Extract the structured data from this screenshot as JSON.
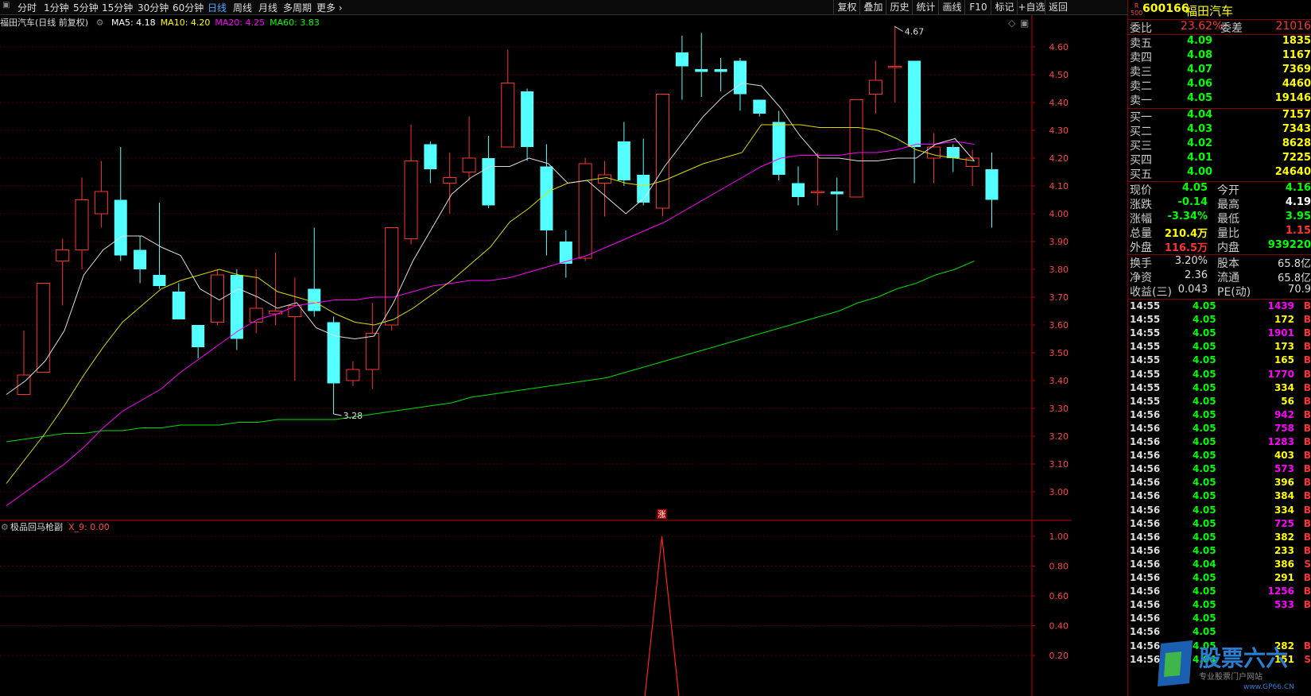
{
  "toolbar": {
    "periods": [
      {
        "label": "分时",
        "active": false
      },
      {
        "label": "1分钟",
        "active": false
      },
      {
        "label": "5分钟",
        "active": false
      },
      {
        "label": "15分钟",
        "active": false
      },
      {
        "label": "30分钟",
        "active": false
      },
      {
        "label": "60分钟",
        "active": false
      },
      {
        "label": "日线",
        "active": true
      },
      {
        "label": "周线",
        "active": false
      },
      {
        "label": "月线",
        "active": false
      },
      {
        "label": "多周期",
        "active": false
      },
      {
        "label": "更多",
        "active": false
      }
    ],
    "right_buttons": [
      "复权",
      "叠加",
      "历史",
      "统计",
      "画线",
      "F10",
      "标记",
      "+自选",
      "返回"
    ]
  },
  "chart_header": {
    "title": "福田汽车(日线 前复权)",
    "ma": [
      {
        "label": "MA5: 4.18",
        "color": "#ffffff"
      },
      {
        "label": "MA10: 4.20",
        "color": "#ffff00"
      },
      {
        "label": "MA20: 4.25",
        "color": "#ff00ff"
      },
      {
        "label": "MA60: 3.83",
        "color": "#00ff00"
      }
    ]
  },
  "chart_data": {
    "type": "candlestick",
    "price_axis": {
      "min": 2.9,
      "max": 4.7,
      "ticks": [
        "4.60",
        "4.50",
        "4.40",
        "4.30",
        "4.20",
        "4.10",
        "4.00",
        "3.90",
        "3.80",
        "3.70",
        "3.60",
        "3.50",
        "3.40",
        "3.30",
        "3.20",
        "3.10",
        "3.00"
      ]
    },
    "candles": [
      {
        "o": 3.35,
        "h": 3.58,
        "l": 3.35,
        "c": 3.42
      },
      {
        "o": 3.43,
        "h": 3.75,
        "l": 3.43,
        "c": 3.75
      },
      {
        "o": 3.83,
        "h": 3.91,
        "l": 3.67,
        "c": 3.87
      },
      {
        "o": 3.87,
        "h": 4.13,
        "l": 3.8,
        "c": 4.05
      },
      {
        "o": 4.0,
        "h": 4.19,
        "l": 3.95,
        "c": 4.08
      },
      {
        "o": 4.05,
        "h": 4.24,
        "l": 3.83,
        "c": 3.85
      },
      {
        "o": 3.87,
        "h": 3.92,
        "l": 3.75,
        "c": 3.8
      },
      {
        "o": 3.78,
        "h": 4.04,
        "l": 3.73,
        "c": 3.74
      },
      {
        "o": 3.72,
        "h": 3.75,
        "l": 3.63,
        "c": 3.62
      },
      {
        "o": 3.6,
        "h": 3.6,
        "l": 3.48,
        "c": 3.52
      },
      {
        "o": 3.61,
        "h": 3.8,
        "l": 3.6,
        "c": 3.78
      },
      {
        "o": 3.78,
        "h": 3.8,
        "l": 3.51,
        "c": 3.55
      },
      {
        "o": 3.61,
        "h": 3.8,
        "l": 3.57,
        "c": 3.66
      },
      {
        "o": 3.64,
        "h": 3.86,
        "l": 3.6,
        "c": 3.65
      },
      {
        "o": 3.63,
        "h": 3.77,
        "l": 3.4,
        "c": 3.67
      },
      {
        "o": 3.73,
        "h": 3.95,
        "l": 3.63,
        "c": 3.65
      },
      {
        "o": 3.61,
        "h": 3.63,
        "l": 3.28,
        "c": 3.39
      },
      {
        "o": 3.4,
        "h": 3.47,
        "l": 3.38,
        "c": 3.44
      },
      {
        "o": 3.44,
        "h": 3.68,
        "l": 3.37,
        "c": 3.57
      },
      {
        "o": 3.6,
        "h": 3.94,
        "l": 3.58,
        "c": 3.95
      },
      {
        "o": 3.91,
        "h": 4.32,
        "l": 3.89,
        "c": 4.19
      },
      {
        "o": 4.25,
        "h": 4.26,
        "l": 4.11,
        "c": 4.16
      },
      {
        "o": 4.11,
        "h": 4.22,
        "l": 4.0,
        "c": 4.13
      },
      {
        "o": 4.15,
        "h": 4.35,
        "l": 4.12,
        "c": 4.2
      },
      {
        "o": 4.2,
        "h": 4.28,
        "l": 4.02,
        "c": 4.03
      },
      {
        "o": 4.24,
        "h": 4.59,
        "l": 4.24,
        "c": 4.47
      },
      {
        "o": 4.44,
        "h": 4.45,
        "l": 4.19,
        "c": 4.24
      },
      {
        "o": 4.17,
        "h": 4.25,
        "l": 3.85,
        "c": 3.94
      },
      {
        "o": 3.9,
        "h": 3.94,
        "l": 3.77,
        "c": 3.82
      },
      {
        "o": 3.84,
        "h": 4.2,
        "l": 3.83,
        "c": 4.18
      },
      {
        "o": 4.11,
        "h": 4.19,
        "l": 3.99,
        "c": 4.14
      },
      {
        "o": 4.26,
        "h": 4.33,
        "l": 4.1,
        "c": 4.12
      },
      {
        "o": 4.14,
        "h": 4.27,
        "l": 4.03,
        "c": 4.04
      },
      {
        "o": 4.02,
        "h": 4.43,
        "l": 3.99,
        "c": 4.43
      },
      {
        "o": 4.58,
        "h": 4.64,
        "l": 4.41,
        "c": 4.53
      },
      {
        "o": 4.52,
        "h": 4.65,
        "l": 4.42,
        "c": 4.51
      },
      {
        "o": 4.52,
        "h": 4.56,
        "l": 4.44,
        "c": 4.51
      },
      {
        "o": 4.55,
        "h": 4.56,
        "l": 4.37,
        "c": 4.43
      },
      {
        "o": 4.41,
        "h": 4.41,
        "l": 4.35,
        "c": 4.36
      },
      {
        "o": 4.33,
        "h": 4.37,
        "l": 4.12,
        "c": 4.14
      },
      {
        "o": 4.11,
        "h": 4.17,
        "l": 4.03,
        "c": 4.06
      },
      {
        "o": 4.08,
        "h": 4.22,
        "l": 4.03,
        "c": 4.08
      },
      {
        "o": 4.08,
        "h": 4.13,
        "l": 3.94,
        "c": 4.07
      },
      {
        "o": 4.06,
        "h": 4.4,
        "l": 4.06,
        "c": 4.41
      },
      {
        "o": 4.43,
        "h": 4.55,
        "l": 4.36,
        "c": 4.48
      },
      {
        "o": 4.53,
        "h": 4.67,
        "l": 4.4,
        "c": 4.53
      },
      {
        "o": 4.55,
        "h": 4.55,
        "l": 4.11,
        "c": 4.24
      },
      {
        "o": 4.2,
        "h": 4.29,
        "l": 4.11,
        "c": 4.24
      },
      {
        "o": 4.24,
        "h": 4.25,
        "l": 4.15,
        "c": 4.2
      },
      {
        "o": 4.17,
        "h": 4.23,
        "l": 4.1,
        "c": 4.2
      },
      {
        "o": 4.16,
        "h": 4.22,
        "l": 3.95,
        "c": 4.05
      }
    ],
    "ma5": [
      3.35,
      3.4,
      3.47,
      3.58,
      3.78,
      3.87,
      3.92,
      3.92,
      3.88,
      3.85,
      3.73,
      3.69,
      3.73,
      3.7,
      3.66,
      3.68,
      3.59,
      3.56,
      3.55,
      3.56,
      3.68,
      3.83,
      3.95,
      4.07,
      4.13,
      4.17,
      4.17,
      4.2,
      4.18,
      4.11,
      4.12,
      4.06,
      4.0,
      4.06,
      4.17,
      4.26,
      4.35,
      4.42,
      4.47,
      4.46,
      4.38,
      4.28,
      4.2,
      4.2,
      4.19,
      4.19,
      4.2,
      4.2,
      4.25,
      4.27,
      4.19
    ],
    "ma10": [
      3.03,
      3.12,
      3.21,
      3.31,
      3.42,
      3.52,
      3.61,
      3.67,
      3.73,
      3.76,
      3.78,
      3.8,
      3.78,
      3.77,
      3.72,
      3.7,
      3.68,
      3.64,
      3.61,
      3.6,
      3.62,
      3.66,
      3.71,
      3.76,
      3.82,
      3.88,
      3.97,
      4.02,
      4.08,
      4.11,
      4.12,
      4.13,
      4.11,
      4.1,
      4.12,
      4.15,
      4.18,
      4.2,
      4.22,
      4.32,
      4.32,
      4.32,
      4.31,
      4.31,
      4.31,
      4.3,
      4.27,
      4.23,
      4.21,
      4.2,
      4.19
    ],
    "ma20": [
      2.95,
      3.0,
      3.05,
      3.1,
      3.16,
      3.23,
      3.29,
      3.33,
      3.37,
      3.43,
      3.48,
      3.53,
      3.58,
      3.62,
      3.64,
      3.67,
      3.68,
      3.69,
      3.69,
      3.7,
      3.7,
      3.72,
      3.74,
      3.75,
      3.76,
      3.76,
      3.77,
      3.79,
      3.81,
      3.83,
      3.85,
      3.88,
      3.91,
      3.94,
      3.97,
      4.01,
      4.05,
      4.09,
      4.13,
      4.17,
      4.2,
      4.21,
      4.21,
      4.21,
      4.22,
      4.22,
      4.23,
      4.25,
      4.25,
      4.26,
      4.25
    ],
    "ma60": [
      3.18,
      3.19,
      3.2,
      3.21,
      3.21,
      3.22,
      3.22,
      3.23,
      3.23,
      3.24,
      3.24,
      3.24,
      3.25,
      3.25,
      3.26,
      3.26,
      3.26,
      3.26,
      3.27,
      3.28,
      3.29,
      3.3,
      3.31,
      3.32,
      3.34,
      3.35,
      3.36,
      3.37,
      3.38,
      3.39,
      3.4,
      3.41,
      3.43,
      3.45,
      3.47,
      3.49,
      3.51,
      3.53,
      3.55,
      3.57,
      3.59,
      3.61,
      3.63,
      3.65,
      3.68,
      3.7,
      3.73,
      3.75,
      3.78,
      3.8,
      3.83
    ],
    "high_label": "4.67",
    "low_label": "3.28"
  },
  "indicator": {
    "name": "极品回马枪副",
    "value_label": "X_9: 0.00",
    "ticks": [
      "1.00",
      "0.80",
      "0.60",
      "0.40",
      "0.20"
    ],
    "signal_label": "涨",
    "signal_value": 1.0
  },
  "quote": {
    "code": "600166",
    "name": "福田汽车",
    "badge_top": "R",
    "badge_bottom": "500",
    "weibi_label": "委比",
    "weibi_value": "23.62%",
    "weicha_label": "委差",
    "weicha_value": "21016",
    "asks": [
      {
        "label": "卖五",
        "price": "4.09",
        "vol": "1835"
      },
      {
        "label": "卖四",
        "price": "4.08",
        "vol": "1167"
      },
      {
        "label": "卖三",
        "price": "4.07",
        "vol": "7369"
      },
      {
        "label": "卖二",
        "price": "4.06",
        "vol": "4460"
      },
      {
        "label": "卖一",
        "price": "4.05",
        "vol": "19146"
      }
    ],
    "bids": [
      {
        "label": "买一",
        "price": "4.04",
        "vol": "7157"
      },
      {
        "label": "买二",
        "price": "4.03",
        "vol": "7343"
      },
      {
        "label": "买三",
        "price": "4.02",
        "vol": "8628"
      },
      {
        "label": "买四",
        "price": "4.01",
        "vol": "7225"
      },
      {
        "label": "买五",
        "price": "4.00",
        "vol": "24640"
      }
    ],
    "stats": [
      {
        "l1": "现价",
        "v1": "4.05",
        "c1": "#00ff00",
        "l2": "今开",
        "v2": "4.16",
        "c2": "#00ff00"
      },
      {
        "l1": "涨跌",
        "v1": "-0.14",
        "c1": "#00ff00",
        "l2": "最高",
        "v2": "4.19",
        "c2": "#ffffff"
      },
      {
        "l1": "涨幅",
        "v1": "-3.34%",
        "c1": "#00ff00",
        "l2": "最低",
        "v2": "3.95",
        "c2": "#00ff00"
      },
      {
        "l1": "总量",
        "v1": "210.4万",
        "c1": "#ffff00",
        "l2": "量比",
        "v2": "1.15",
        "c2": "#ff3333"
      },
      {
        "l1": "外盘",
        "v1": "116.5万",
        "c1": "#ff3333",
        "l2": "内盘",
        "v2": "939220",
        "c2": "#00ff00"
      }
    ],
    "stats2": [
      {
        "l1": "换手",
        "v1": "3.20%",
        "l2": "股本",
        "v2": "65.8亿"
      },
      {
        "l1": "净资",
        "v1": "2.36",
        "l2": "流通",
        "v2": "65.8亿"
      },
      {
        "l1": "收益(三)",
        "v1": "0.043",
        "l2": "PE(动)",
        "v2": "70.9"
      }
    ],
    "ticks": [
      {
        "time": "14:55",
        "price": "4.05",
        "vol": "1439",
        "vc": "#ff00ff",
        "bs": "B"
      },
      {
        "time": "14:55",
        "price": "4.05",
        "vol": "172",
        "vc": "#ffff00",
        "bs": "B"
      },
      {
        "time": "14:55",
        "price": "4.05",
        "vol": "1901",
        "vc": "#ff00ff",
        "bs": "B"
      },
      {
        "time": "14:55",
        "price": "4.05",
        "vol": "173",
        "vc": "#ffff00",
        "bs": "B"
      },
      {
        "time": "14:55",
        "price": "4.05",
        "vol": "165",
        "vc": "#ffff00",
        "bs": "B"
      },
      {
        "time": "14:55",
        "price": "4.05",
        "vol": "1770",
        "vc": "#ff00ff",
        "bs": "B"
      },
      {
        "time": "14:55",
        "price": "4.05",
        "vol": "334",
        "vc": "#ffff00",
        "bs": "B"
      },
      {
        "time": "14:55",
        "price": "4.05",
        "vol": "56",
        "vc": "#ffff00",
        "bs": "B"
      },
      {
        "time": "14:56",
        "price": "4.05",
        "vol": "942",
        "vc": "#ff00ff",
        "bs": "B"
      },
      {
        "time": "14:56",
        "price": "4.05",
        "vol": "758",
        "vc": "#ff00ff",
        "bs": "B"
      },
      {
        "time": "14:56",
        "price": "4.05",
        "vol": "1283",
        "vc": "#ff00ff",
        "bs": "B"
      },
      {
        "time": "14:56",
        "price": "4.05",
        "vol": "403",
        "vc": "#ffff00",
        "bs": "B"
      },
      {
        "time": "14:56",
        "price": "4.05",
        "vol": "573",
        "vc": "#ff00ff",
        "bs": "B"
      },
      {
        "time": "14:56",
        "price": "4.05",
        "vol": "396",
        "vc": "#ffff00",
        "bs": "B"
      },
      {
        "time": "14:56",
        "price": "4.05",
        "vol": "384",
        "vc": "#ffff00",
        "bs": "B"
      },
      {
        "time": "14:56",
        "price": "4.05",
        "vol": "334",
        "vc": "#ffff00",
        "bs": "B"
      },
      {
        "time": "14:56",
        "price": "4.05",
        "vol": "725",
        "vc": "#ff00ff",
        "bs": "B"
      },
      {
        "time": "14:56",
        "price": "4.05",
        "vol": "382",
        "vc": "#ffff00",
        "bs": "B"
      },
      {
        "time": "14:56",
        "price": "4.05",
        "vol": "233",
        "vc": "#ffff00",
        "bs": "B"
      },
      {
        "time": "14:56",
        "price": "4.04",
        "vol": "386",
        "vc": "#ffff00",
        "bs": "S"
      },
      {
        "time": "14:56",
        "price": "4.05",
        "vol": "291",
        "vc": "#ffff00",
        "bs": "B"
      },
      {
        "time": "14:56",
        "price": "4.05",
        "vol": "1256",
        "vc": "#ff00ff",
        "bs": "B"
      },
      {
        "time": "14:56",
        "price": "4.05",
        "vol": "533",
        "vc": "#ff00ff",
        "bs": "B"
      },
      {
        "time": "14:56",
        "price": "4.05",
        "vol": "",
        "vc": "#ffff00",
        "bs": ""
      },
      {
        "time": "14:56",
        "price": "4.05",
        "vol": "",
        "vc": "#ffff00",
        "bs": ""
      },
      {
        "time": "14:56",
        "price": "4.05",
        "vol": "282",
        "vc": "#ffff00",
        "bs": "B"
      },
      {
        "time": "14:56",
        "price": "4.04",
        "vol": "151",
        "vc": "#ffff00",
        "bs": "S"
      }
    ]
  },
  "watermark": {
    "title": "股票六六",
    "url": "www.GP66.CN",
    "slogan": "专业股票门户网站"
  },
  "colors": {
    "up": "#ff3232",
    "down": "#54ffff",
    "grid": "#5a0000",
    "axis": "#c00000"
  }
}
